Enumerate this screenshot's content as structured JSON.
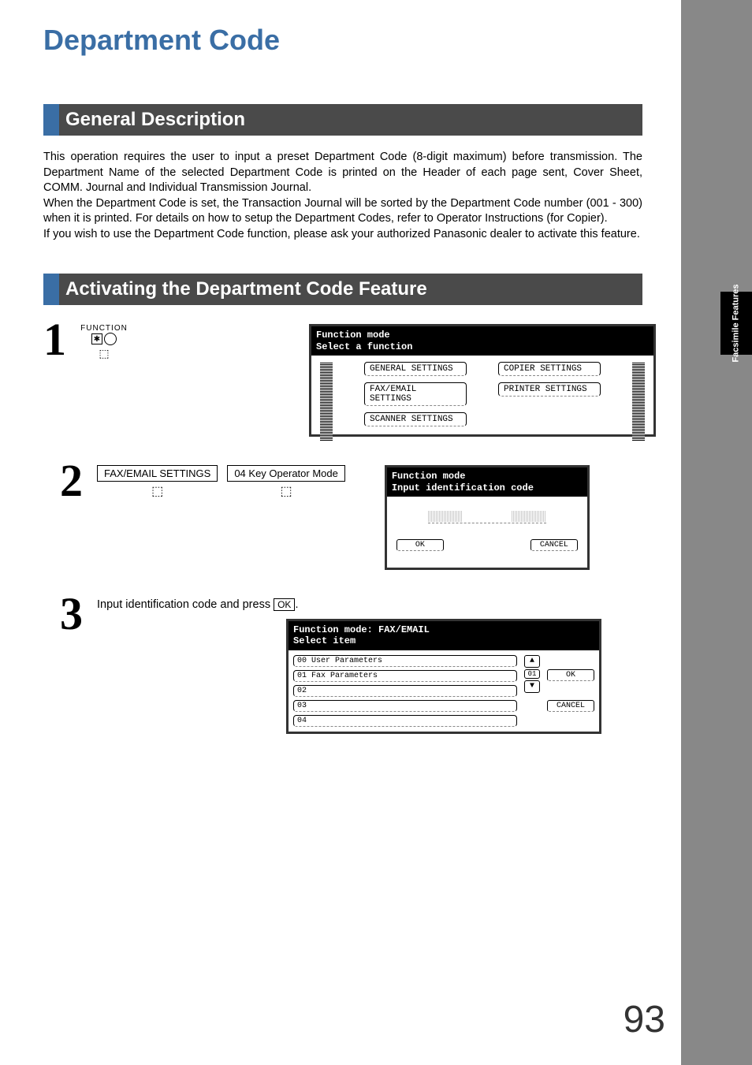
{
  "sideTab": "Facsimile\nFeatures",
  "title": "Department Code",
  "section1": {
    "heading": "General Description"
  },
  "intro": "This operation requires the user to input a preset Department Code (8-digit maximum) before transmission. The Department Name of the selected Department Code is printed on the Header of each page sent, Cover Sheet, COMM. Journal and Individual Transmission Journal.\nWhen the Department Code is set, the Transaction Journal will be sorted by the Department Code number (001 - 300) when it is printed. For details on how to setup the Department Codes, refer to Operator Instructions (for Copier).\nIf you wish to use the Department Code function, please ask your authorized Panasonic dealer to activate this feature.",
  "section2": {
    "heading": "Activating the Department Code Feature"
  },
  "step1": {
    "num": "1",
    "functionKeyLabel": "FUNCTION",
    "functionKeyStar": "✱",
    "lcd": {
      "title": "Function mode",
      "subtitle": "Select a function",
      "buttonsLeft": [
        "GENERAL SETTINGS",
        "FAX/EMAIL SETTINGS",
        "SCANNER SETTINGS"
      ],
      "buttonsRight": [
        "COPIER SETTINGS",
        "PRINTER SETTINGS"
      ]
    }
  },
  "step2": {
    "num": "2",
    "btn1": "FAX/EMAIL SETTINGS",
    "btn2": "04 Key Operator Mode",
    "lcd": {
      "title": "Function mode",
      "subtitle": "Input identification code",
      "ok": "OK",
      "cancel": "CANCEL"
    }
  },
  "step3": {
    "num": "3",
    "text_a": "Input identification code and press ",
    "okLabel": "OK",
    "text_b": ".",
    "lcd": {
      "title": "Function mode: FAX/EMAIL",
      "subtitle": "Select item",
      "items": [
        {
          "n": "00",
          "label": "User Parameters"
        },
        {
          "n": "01",
          "label": "Fax Parameters"
        },
        {
          "n": "02",
          "label": ""
        },
        {
          "n": "03",
          "label": ""
        },
        {
          "n": "04",
          "label": ""
        }
      ],
      "pager": "01",
      "ok": "OK",
      "cancel": "CANCEL"
    }
  },
  "pageNumber": "93"
}
